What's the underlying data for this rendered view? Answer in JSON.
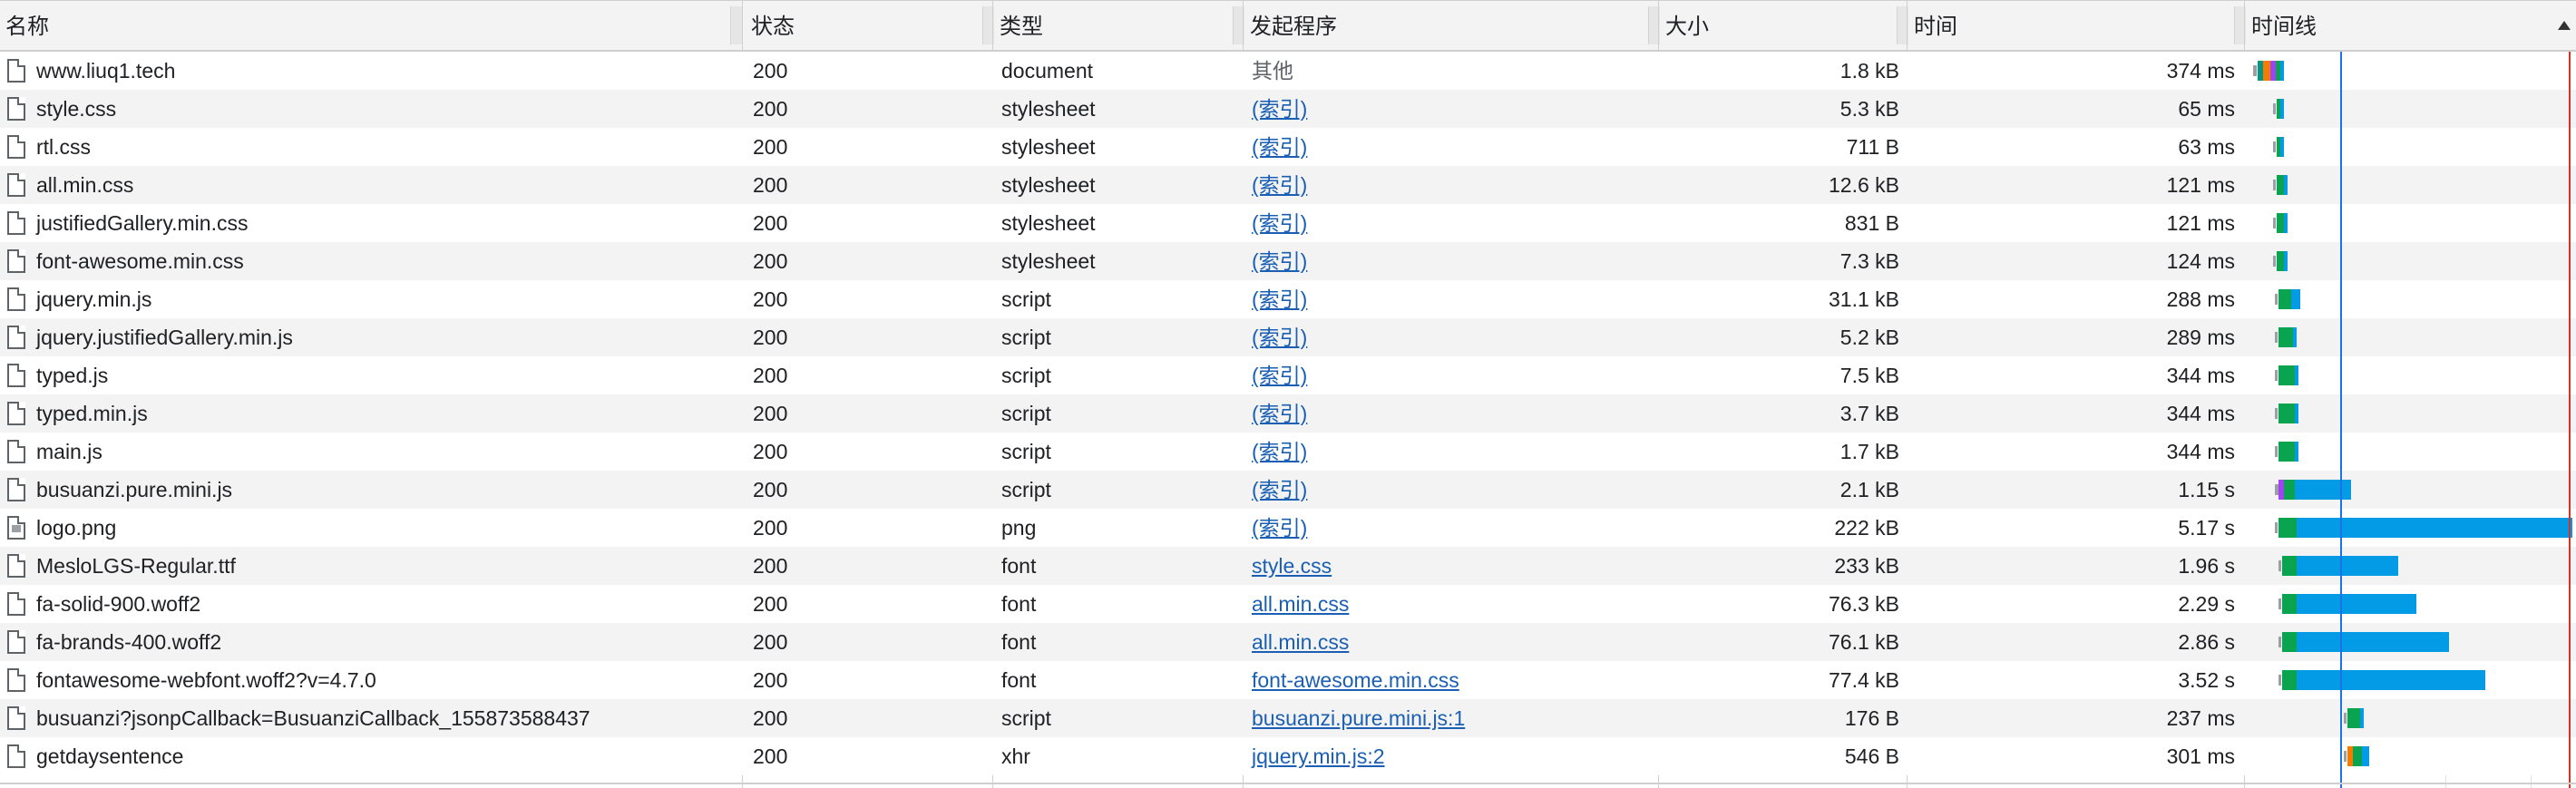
{
  "columns": {
    "name": "名称",
    "status": "状态",
    "type": "类型",
    "initiator": "发起程序",
    "size": "大小",
    "time": "时间",
    "waterfall": "时间线"
  },
  "colors": {
    "header_bg": "#f3f3f3",
    "row_alt_bg": "#f3f3f3",
    "link": "#1a5fb4",
    "waiting": "#9aa0a6",
    "dns": "#009688",
    "connect": "#f57c00",
    "ssl": "#a142f4",
    "ttfb": "#0aa34f",
    "download": "#039be5",
    "dom_content_loaded_line": "#1a73e8",
    "load_line": "#d93025"
  },
  "rows": [
    {
      "name": "www.liuq1.tech",
      "icon": "document-icon",
      "status": "200",
      "type": "document",
      "initiator": "其他",
      "initiator_link": false,
      "size": "1.8 kB",
      "time": "374 ms"
    },
    {
      "name": "style.css",
      "icon": "document-icon",
      "status": "200",
      "type": "stylesheet",
      "initiator": "(索引)",
      "initiator_link": true,
      "size": "5.3 kB",
      "time": "65 ms"
    },
    {
      "name": "rtl.css",
      "icon": "document-icon",
      "status": "200",
      "type": "stylesheet",
      "initiator": "(索引)",
      "initiator_link": true,
      "size": "711 B",
      "time": "63 ms"
    },
    {
      "name": "all.min.css",
      "icon": "document-icon",
      "status": "200",
      "type": "stylesheet",
      "initiator": "(索引)",
      "initiator_link": true,
      "size": "12.6 kB",
      "time": "121 ms"
    },
    {
      "name": "justifiedGallery.min.css",
      "icon": "document-icon",
      "status": "200",
      "type": "stylesheet",
      "initiator": "(索引)",
      "initiator_link": true,
      "size": "831 B",
      "time": "121 ms"
    },
    {
      "name": "font-awesome.min.css",
      "icon": "document-icon",
      "status": "200",
      "type": "stylesheet",
      "initiator": "(索引)",
      "initiator_link": true,
      "size": "7.3 kB",
      "time": "124 ms"
    },
    {
      "name": "jquery.min.js",
      "icon": "document-icon",
      "status": "200",
      "type": "script",
      "initiator": "(索引)",
      "initiator_link": true,
      "size": "31.1 kB",
      "time": "288 ms"
    },
    {
      "name": "jquery.justifiedGallery.min.js",
      "icon": "document-icon",
      "status": "200",
      "type": "script",
      "initiator": "(索引)",
      "initiator_link": true,
      "size": "5.2 kB",
      "time": "289 ms"
    },
    {
      "name": "typed.js",
      "icon": "document-icon",
      "status": "200",
      "type": "script",
      "initiator": "(索引)",
      "initiator_link": true,
      "size": "7.5 kB",
      "time": "344 ms"
    },
    {
      "name": "typed.min.js",
      "icon": "document-icon",
      "status": "200",
      "type": "script",
      "initiator": "(索引)",
      "initiator_link": true,
      "size": "3.7 kB",
      "time": "344 ms"
    },
    {
      "name": "main.js",
      "icon": "document-icon",
      "status": "200",
      "type": "script",
      "initiator": "(索引)",
      "initiator_link": true,
      "size": "1.7 kB",
      "time": "344 ms"
    },
    {
      "name": "busuanzi.pure.mini.js",
      "icon": "document-icon",
      "status": "200",
      "type": "script",
      "initiator": "(索引)",
      "initiator_link": true,
      "size": "2.1 kB",
      "time": "1.15 s"
    },
    {
      "name": "logo.png",
      "icon": "image-icon",
      "status": "200",
      "type": "png",
      "initiator": "(索引)",
      "initiator_link": true,
      "size": "222 kB",
      "time": "5.17 s"
    },
    {
      "name": "MesloLGS-Regular.ttf",
      "icon": "document-icon",
      "status": "200",
      "type": "font",
      "initiator": "style.css",
      "initiator_link": true,
      "size": "233 kB",
      "time": "1.96 s"
    },
    {
      "name": "fa-solid-900.woff2",
      "icon": "document-icon",
      "status": "200",
      "type": "font",
      "initiator": "all.min.css",
      "initiator_link": true,
      "size": "76.3 kB",
      "time": "2.29 s"
    },
    {
      "name": "fa-brands-400.woff2",
      "icon": "document-icon",
      "status": "200",
      "type": "font",
      "initiator": "all.min.css",
      "initiator_link": true,
      "size": "76.1 kB",
      "time": "2.86 s"
    },
    {
      "name": "fontawesome-webfont.woff2?v=4.7.0",
      "icon": "document-icon",
      "status": "200",
      "type": "font",
      "initiator": "font-awesome.min.css",
      "initiator_link": true,
      "size": "77.4 kB",
      "time": "3.52 s"
    },
    {
      "name": "busuanzi?jsonpCallback=BusuanziCallback_155873588437",
      "icon": "document-icon",
      "status": "200",
      "type": "script",
      "initiator": "busuanzi.pure.mini.js:1",
      "initiator_link": true,
      "size": "176 B",
      "time": "237 ms"
    },
    {
      "name": "getdaysentence",
      "icon": "document-icon",
      "status": "200",
      "type": "xhr",
      "initiator": "jquery.min.js:2",
      "initiator_link": true,
      "size": "546 B",
      "time": "301 ms"
    }
  ]
}
